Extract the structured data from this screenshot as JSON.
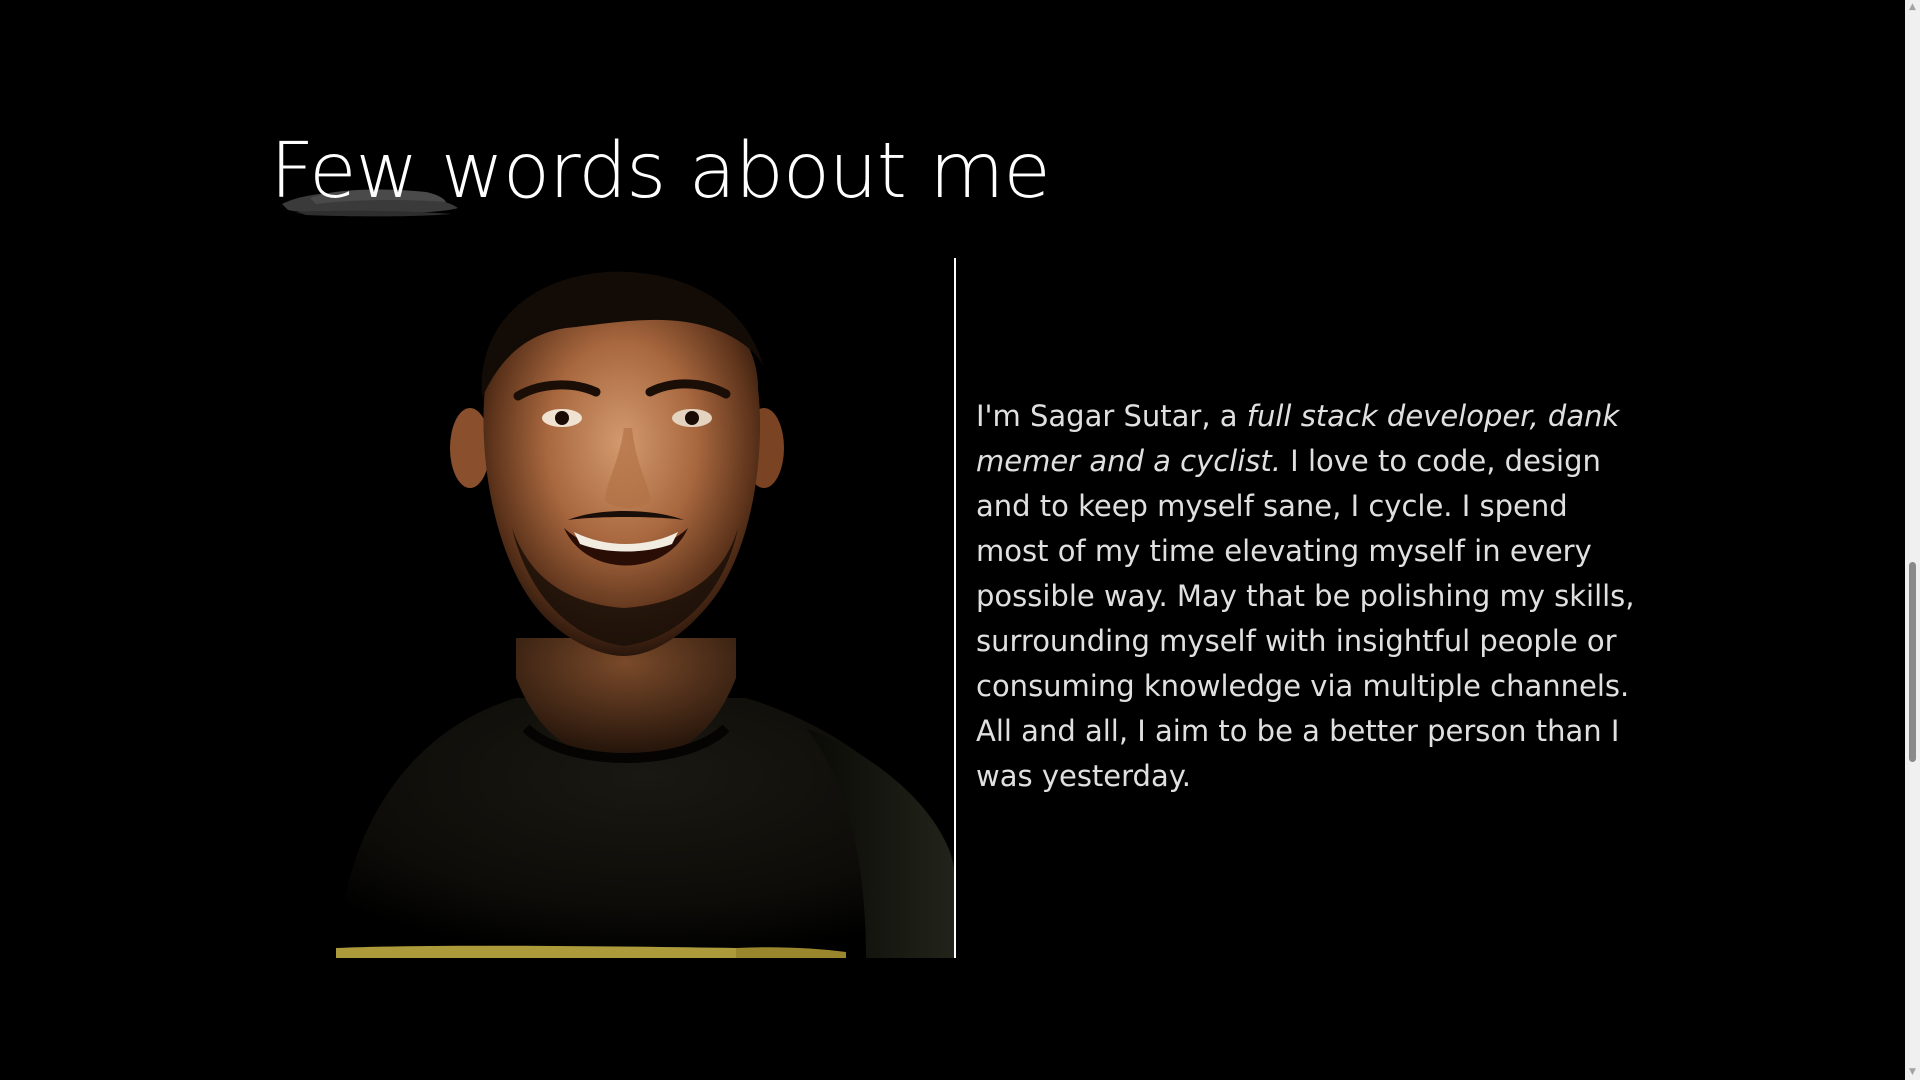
{
  "about": {
    "heading": "Few words about me",
    "photo_alt": "Portrait of Sagar Sutar",
    "bio": {
      "intro": "I'm Sagar Sutar, a ",
      "emphasis": "full stack developer, dank memer and a cyclist.",
      "rest": " I love to code, design and to keep myself sane, I cycle. I spend most of my time elevating myself in every possible way. May that be polishing my skills, surrounding myself with insightful people or consuming knowledge via multiple channels. All and all, I aim to be a better person than I was yesterday."
    }
  },
  "scrollbar": {
    "up_glyph": "▲",
    "down_glyph": "▼",
    "position": 0.55
  },
  "colors": {
    "background": "#000000",
    "heading": "#ffffff",
    "text": "#e0e0e0",
    "brush": "#3a3a3a",
    "divider": "#ffffff"
  }
}
